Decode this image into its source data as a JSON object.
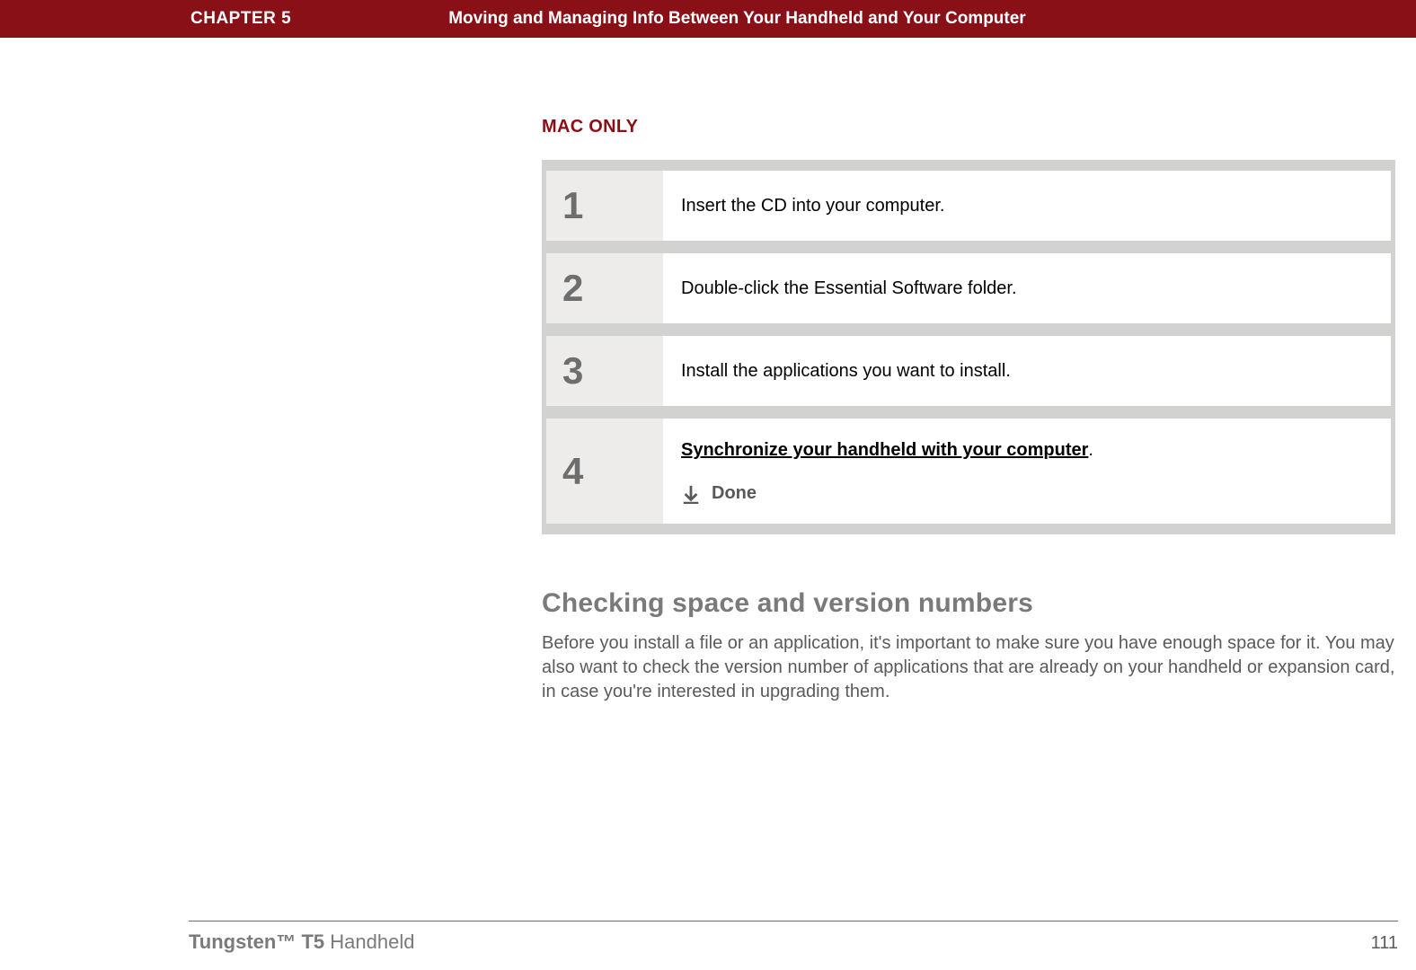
{
  "header": {
    "chapter_label": "CHAPTER 5",
    "chapter_title": "Moving and Managing Info Between Your Handheld and Your Computer"
  },
  "platform_label": "MAC ONLY",
  "steps": [
    {
      "num": "1",
      "text": "Insert the CD into your computer."
    },
    {
      "num": "2",
      "text": "Double-click the Essential Software folder."
    },
    {
      "num": "3",
      "text": "Install the applications you want to install."
    },
    {
      "num": "4",
      "link_text": "Synchronize your handheld with your computer",
      "link_suffix": "."
    }
  ],
  "done_label": "Done",
  "section": {
    "heading": "Checking space and version numbers",
    "paragraph": "Before you install a file or an application, it's important to make sure you have enough space for it. You may also want to check the version number of applications that are already on your handheld or expansion card, in case you're interested in upgrading them."
  },
  "footer": {
    "product_bold": "Tungsten™ T5",
    "product_rest": " Handheld",
    "page_number": "111"
  }
}
